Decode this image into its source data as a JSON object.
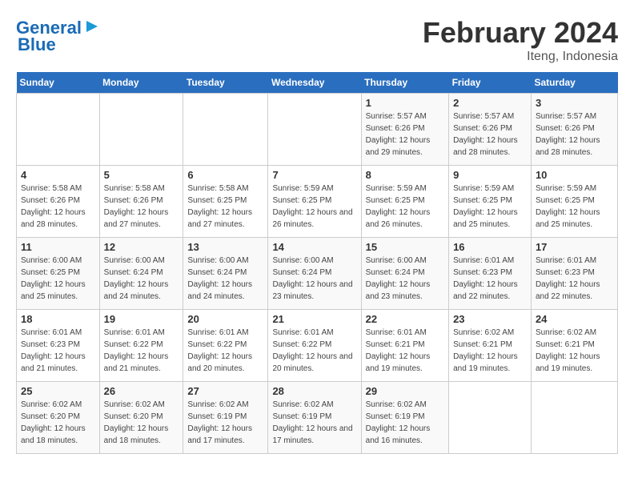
{
  "logo": {
    "line1": "General",
    "line2": "Blue"
  },
  "title": {
    "month": "February 2024",
    "location": "Iteng, Indonesia"
  },
  "weekdays": [
    "Sunday",
    "Monday",
    "Tuesday",
    "Wednesday",
    "Thursday",
    "Friday",
    "Saturday"
  ],
  "weeks": [
    [
      null,
      null,
      null,
      null,
      {
        "day": "1",
        "sunrise": "5:57 AM",
        "sunset": "6:26 PM",
        "daylight": "12 hours and 29 minutes."
      },
      {
        "day": "2",
        "sunrise": "5:57 AM",
        "sunset": "6:26 PM",
        "daylight": "12 hours and 28 minutes."
      },
      {
        "day": "3",
        "sunrise": "5:57 AM",
        "sunset": "6:26 PM",
        "daylight": "12 hours and 28 minutes."
      }
    ],
    [
      {
        "day": "4",
        "sunrise": "5:58 AM",
        "sunset": "6:26 PM",
        "daylight": "12 hours and 28 minutes."
      },
      {
        "day": "5",
        "sunrise": "5:58 AM",
        "sunset": "6:26 PM",
        "daylight": "12 hours and 27 minutes."
      },
      {
        "day": "6",
        "sunrise": "5:58 AM",
        "sunset": "6:25 PM",
        "daylight": "12 hours and 27 minutes."
      },
      {
        "day": "7",
        "sunrise": "5:59 AM",
        "sunset": "6:25 PM",
        "daylight": "12 hours and 26 minutes."
      },
      {
        "day": "8",
        "sunrise": "5:59 AM",
        "sunset": "6:25 PM",
        "daylight": "12 hours and 26 minutes."
      },
      {
        "day": "9",
        "sunrise": "5:59 AM",
        "sunset": "6:25 PM",
        "daylight": "12 hours and 25 minutes."
      },
      {
        "day": "10",
        "sunrise": "5:59 AM",
        "sunset": "6:25 PM",
        "daylight": "12 hours and 25 minutes."
      }
    ],
    [
      {
        "day": "11",
        "sunrise": "6:00 AM",
        "sunset": "6:25 PM",
        "daylight": "12 hours and 25 minutes."
      },
      {
        "day": "12",
        "sunrise": "6:00 AM",
        "sunset": "6:24 PM",
        "daylight": "12 hours and 24 minutes."
      },
      {
        "day": "13",
        "sunrise": "6:00 AM",
        "sunset": "6:24 PM",
        "daylight": "12 hours and 24 minutes."
      },
      {
        "day": "14",
        "sunrise": "6:00 AM",
        "sunset": "6:24 PM",
        "daylight": "12 hours and 23 minutes."
      },
      {
        "day": "15",
        "sunrise": "6:00 AM",
        "sunset": "6:24 PM",
        "daylight": "12 hours and 23 minutes."
      },
      {
        "day": "16",
        "sunrise": "6:01 AM",
        "sunset": "6:23 PM",
        "daylight": "12 hours and 22 minutes."
      },
      {
        "day": "17",
        "sunrise": "6:01 AM",
        "sunset": "6:23 PM",
        "daylight": "12 hours and 22 minutes."
      }
    ],
    [
      {
        "day": "18",
        "sunrise": "6:01 AM",
        "sunset": "6:23 PM",
        "daylight": "12 hours and 21 minutes."
      },
      {
        "day": "19",
        "sunrise": "6:01 AM",
        "sunset": "6:22 PM",
        "daylight": "12 hours and 21 minutes."
      },
      {
        "day": "20",
        "sunrise": "6:01 AM",
        "sunset": "6:22 PM",
        "daylight": "12 hours and 20 minutes."
      },
      {
        "day": "21",
        "sunrise": "6:01 AM",
        "sunset": "6:22 PM",
        "daylight": "12 hours and 20 minutes."
      },
      {
        "day": "22",
        "sunrise": "6:01 AM",
        "sunset": "6:21 PM",
        "daylight": "12 hours and 19 minutes."
      },
      {
        "day": "23",
        "sunrise": "6:02 AM",
        "sunset": "6:21 PM",
        "daylight": "12 hours and 19 minutes."
      },
      {
        "day": "24",
        "sunrise": "6:02 AM",
        "sunset": "6:21 PM",
        "daylight": "12 hours and 19 minutes."
      }
    ],
    [
      {
        "day": "25",
        "sunrise": "6:02 AM",
        "sunset": "6:20 PM",
        "daylight": "12 hours and 18 minutes."
      },
      {
        "day": "26",
        "sunrise": "6:02 AM",
        "sunset": "6:20 PM",
        "daylight": "12 hours and 18 minutes."
      },
      {
        "day": "27",
        "sunrise": "6:02 AM",
        "sunset": "6:19 PM",
        "daylight": "12 hours and 17 minutes."
      },
      {
        "day": "28",
        "sunrise": "6:02 AM",
        "sunset": "6:19 PM",
        "daylight": "12 hours and 17 minutes."
      },
      {
        "day": "29",
        "sunrise": "6:02 AM",
        "sunset": "6:19 PM",
        "daylight": "12 hours and 16 minutes."
      },
      null,
      null
    ]
  ],
  "labels": {
    "sunrise": "Sunrise:",
    "sunset": "Sunset:",
    "daylight": "Daylight:"
  }
}
